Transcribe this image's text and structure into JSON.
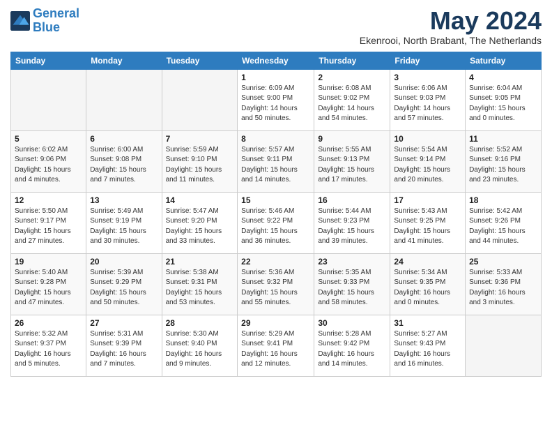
{
  "logo": {
    "line1": "General",
    "line2": "Blue"
  },
  "title": "May 2024",
  "location": "Ekenrooi, North Brabant, The Netherlands",
  "weekdays": [
    "Sunday",
    "Monday",
    "Tuesday",
    "Wednesday",
    "Thursday",
    "Friday",
    "Saturday"
  ],
  "weeks": [
    [
      {
        "day": "",
        "info": ""
      },
      {
        "day": "",
        "info": ""
      },
      {
        "day": "",
        "info": ""
      },
      {
        "day": "1",
        "info": "Sunrise: 6:09 AM\nSunset: 9:00 PM\nDaylight: 14 hours\nand 50 minutes."
      },
      {
        "day": "2",
        "info": "Sunrise: 6:08 AM\nSunset: 9:02 PM\nDaylight: 14 hours\nand 54 minutes."
      },
      {
        "day": "3",
        "info": "Sunrise: 6:06 AM\nSunset: 9:03 PM\nDaylight: 14 hours\nand 57 minutes."
      },
      {
        "day": "4",
        "info": "Sunrise: 6:04 AM\nSunset: 9:05 PM\nDaylight: 15 hours\nand 0 minutes."
      }
    ],
    [
      {
        "day": "5",
        "info": "Sunrise: 6:02 AM\nSunset: 9:06 PM\nDaylight: 15 hours\nand 4 minutes."
      },
      {
        "day": "6",
        "info": "Sunrise: 6:00 AM\nSunset: 9:08 PM\nDaylight: 15 hours\nand 7 minutes."
      },
      {
        "day": "7",
        "info": "Sunrise: 5:59 AM\nSunset: 9:10 PM\nDaylight: 15 hours\nand 11 minutes."
      },
      {
        "day": "8",
        "info": "Sunrise: 5:57 AM\nSunset: 9:11 PM\nDaylight: 15 hours\nand 14 minutes."
      },
      {
        "day": "9",
        "info": "Sunrise: 5:55 AM\nSunset: 9:13 PM\nDaylight: 15 hours\nand 17 minutes."
      },
      {
        "day": "10",
        "info": "Sunrise: 5:54 AM\nSunset: 9:14 PM\nDaylight: 15 hours\nand 20 minutes."
      },
      {
        "day": "11",
        "info": "Sunrise: 5:52 AM\nSunset: 9:16 PM\nDaylight: 15 hours\nand 23 minutes."
      }
    ],
    [
      {
        "day": "12",
        "info": "Sunrise: 5:50 AM\nSunset: 9:17 PM\nDaylight: 15 hours\nand 27 minutes."
      },
      {
        "day": "13",
        "info": "Sunrise: 5:49 AM\nSunset: 9:19 PM\nDaylight: 15 hours\nand 30 minutes."
      },
      {
        "day": "14",
        "info": "Sunrise: 5:47 AM\nSunset: 9:20 PM\nDaylight: 15 hours\nand 33 minutes."
      },
      {
        "day": "15",
        "info": "Sunrise: 5:46 AM\nSunset: 9:22 PM\nDaylight: 15 hours\nand 36 minutes."
      },
      {
        "day": "16",
        "info": "Sunrise: 5:44 AM\nSunset: 9:23 PM\nDaylight: 15 hours\nand 39 minutes."
      },
      {
        "day": "17",
        "info": "Sunrise: 5:43 AM\nSunset: 9:25 PM\nDaylight: 15 hours\nand 41 minutes."
      },
      {
        "day": "18",
        "info": "Sunrise: 5:42 AM\nSunset: 9:26 PM\nDaylight: 15 hours\nand 44 minutes."
      }
    ],
    [
      {
        "day": "19",
        "info": "Sunrise: 5:40 AM\nSunset: 9:28 PM\nDaylight: 15 hours\nand 47 minutes."
      },
      {
        "day": "20",
        "info": "Sunrise: 5:39 AM\nSunset: 9:29 PM\nDaylight: 15 hours\nand 50 minutes."
      },
      {
        "day": "21",
        "info": "Sunrise: 5:38 AM\nSunset: 9:31 PM\nDaylight: 15 hours\nand 53 minutes."
      },
      {
        "day": "22",
        "info": "Sunrise: 5:36 AM\nSunset: 9:32 PM\nDaylight: 15 hours\nand 55 minutes."
      },
      {
        "day": "23",
        "info": "Sunrise: 5:35 AM\nSunset: 9:33 PM\nDaylight: 15 hours\nand 58 minutes."
      },
      {
        "day": "24",
        "info": "Sunrise: 5:34 AM\nSunset: 9:35 PM\nDaylight: 16 hours\nand 0 minutes."
      },
      {
        "day": "25",
        "info": "Sunrise: 5:33 AM\nSunset: 9:36 PM\nDaylight: 16 hours\nand 3 minutes."
      }
    ],
    [
      {
        "day": "26",
        "info": "Sunrise: 5:32 AM\nSunset: 9:37 PM\nDaylight: 16 hours\nand 5 minutes."
      },
      {
        "day": "27",
        "info": "Sunrise: 5:31 AM\nSunset: 9:39 PM\nDaylight: 16 hours\nand 7 minutes."
      },
      {
        "day": "28",
        "info": "Sunrise: 5:30 AM\nSunset: 9:40 PM\nDaylight: 16 hours\nand 9 minutes."
      },
      {
        "day": "29",
        "info": "Sunrise: 5:29 AM\nSunset: 9:41 PM\nDaylight: 16 hours\nand 12 minutes."
      },
      {
        "day": "30",
        "info": "Sunrise: 5:28 AM\nSunset: 9:42 PM\nDaylight: 16 hours\nand 14 minutes."
      },
      {
        "day": "31",
        "info": "Sunrise: 5:27 AM\nSunset: 9:43 PM\nDaylight: 16 hours\nand 16 minutes."
      },
      {
        "day": "",
        "info": ""
      }
    ]
  ]
}
